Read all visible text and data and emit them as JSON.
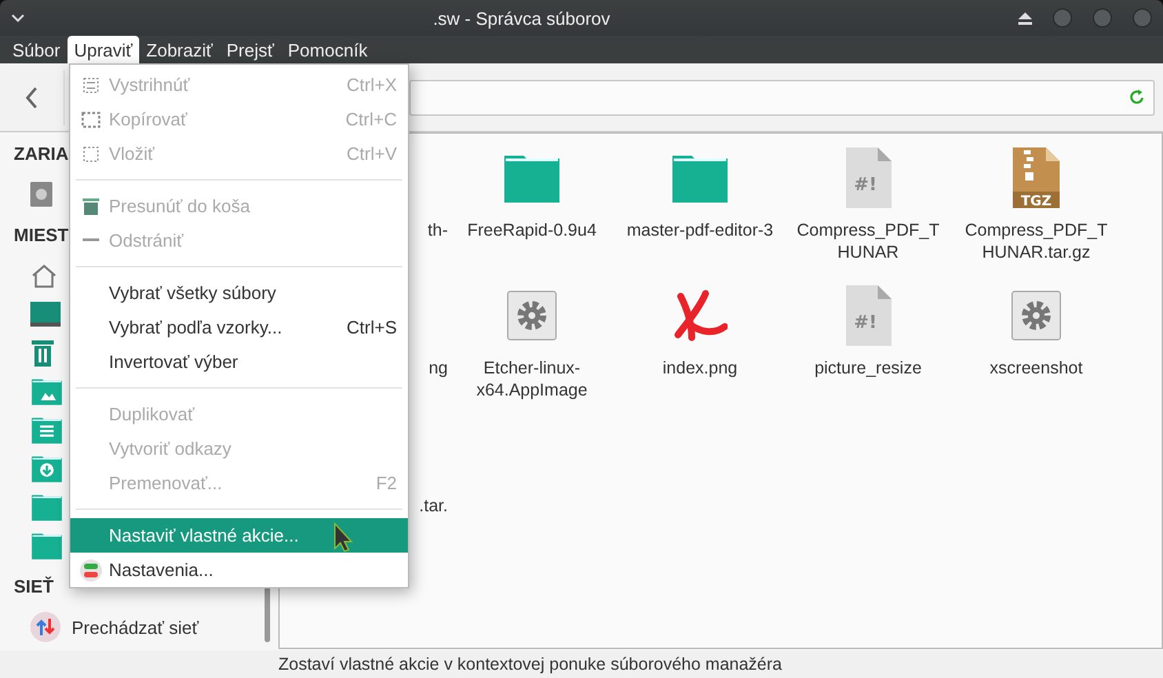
{
  "window": {
    "title": ".sw - Správca súborov"
  },
  "menubar": [
    {
      "label": "Súbor",
      "selected": false
    },
    {
      "label": "Upraviť",
      "selected": true
    },
    {
      "label": "Zobraziť",
      "selected": false
    },
    {
      "label": "Prejsť",
      "selected": false
    },
    {
      "label": "Pomocník",
      "selected": false
    }
  ],
  "edit_menu": [
    {
      "kind": "item",
      "label": "Vystrihnúť",
      "shortcut": "Ctrl+X",
      "disabled": true,
      "selected": false
    },
    {
      "kind": "item",
      "label": "Kopírovať",
      "shortcut": "Ctrl+C",
      "disabled": true,
      "selected": false
    },
    {
      "kind": "item",
      "label": "Vložiť",
      "shortcut": "Ctrl+V",
      "disabled": true,
      "selected": false
    },
    {
      "kind": "separator"
    },
    {
      "kind": "item",
      "label": "Presunúť do koša",
      "disabled": true,
      "selected": false
    },
    {
      "kind": "item",
      "label": "Odstrániť",
      "disabled": true,
      "selected": false
    },
    {
      "kind": "separator"
    },
    {
      "kind": "item",
      "label": "Vybrať všetky súbory",
      "disabled": false,
      "selected": false
    },
    {
      "kind": "item",
      "label": "Vybrať podľa vzorky...",
      "shortcut": "Ctrl+S",
      "disabled": false,
      "selected": false
    },
    {
      "kind": "item",
      "label": "Invertovať výber",
      "disabled": false,
      "selected": false
    },
    {
      "kind": "separator"
    },
    {
      "kind": "item",
      "label": "Duplikovať",
      "disabled": true,
      "selected": false
    },
    {
      "kind": "item",
      "label": "Vytvoriť odkazy",
      "disabled": true,
      "selected": false
    },
    {
      "kind": "item",
      "label": "Premenovať...",
      "shortcut": "F2",
      "disabled": true,
      "selected": false
    },
    {
      "kind": "separator"
    },
    {
      "kind": "item",
      "label": "Nastaviť vlastné akcie...",
      "disabled": false,
      "selected": true
    },
    {
      "kind": "item",
      "label": "Nastavenia...",
      "disabled": false,
      "selected": false
    }
  ],
  "sidebar": [
    {
      "heading": "ZARIA",
      "items": [
        {
          "kind": "drive"
        }
      ]
    },
    {
      "heading": "MIEST",
      "items": [
        {
          "kind": "home"
        },
        {
          "kind": "desktop"
        },
        {
          "kind": "trash"
        },
        {
          "kind": "pictures"
        },
        {
          "kind": "documents"
        },
        {
          "kind": "downloads"
        },
        {
          "kind": "folder"
        },
        {
          "kind": "folder"
        }
      ]
    },
    {
      "heading": "SIEŤ",
      "items": [
        {
          "kind": "network",
          "label": "Prechádzať sieť"
        }
      ]
    }
  ],
  "files": [
    {
      "kind": "hidden",
      "name": "th-"
    },
    {
      "kind": "folder",
      "name": "FreeRapid-0.9u4"
    },
    {
      "kind": "folder",
      "name": "master-pdf-editor-3"
    },
    {
      "kind": "script",
      "name": "Compress_PDF_THUNAR",
      "icon_text": "#!"
    },
    {
      "kind": "archive",
      "name": "Compress_PDF_THUNAR.tar.gz",
      "icon_text": "TGZ"
    },
    {
      "kind": "hidden",
      "name": "ng"
    },
    {
      "kind": "executable",
      "name": "Etcher-linux-x64.AppImage"
    },
    {
      "kind": "image",
      "name": "index.png"
    },
    {
      "kind": "script",
      "name": "picture_resize",
      "icon_text": "#!"
    },
    {
      "kind": "executable",
      "name": "xscreenshot"
    },
    {
      "kind": "hidden",
      "name": ".tar."
    }
  ],
  "status_bar": "Zostaví vlastné akcie v kontextovej ponuke súborového manažéra"
}
